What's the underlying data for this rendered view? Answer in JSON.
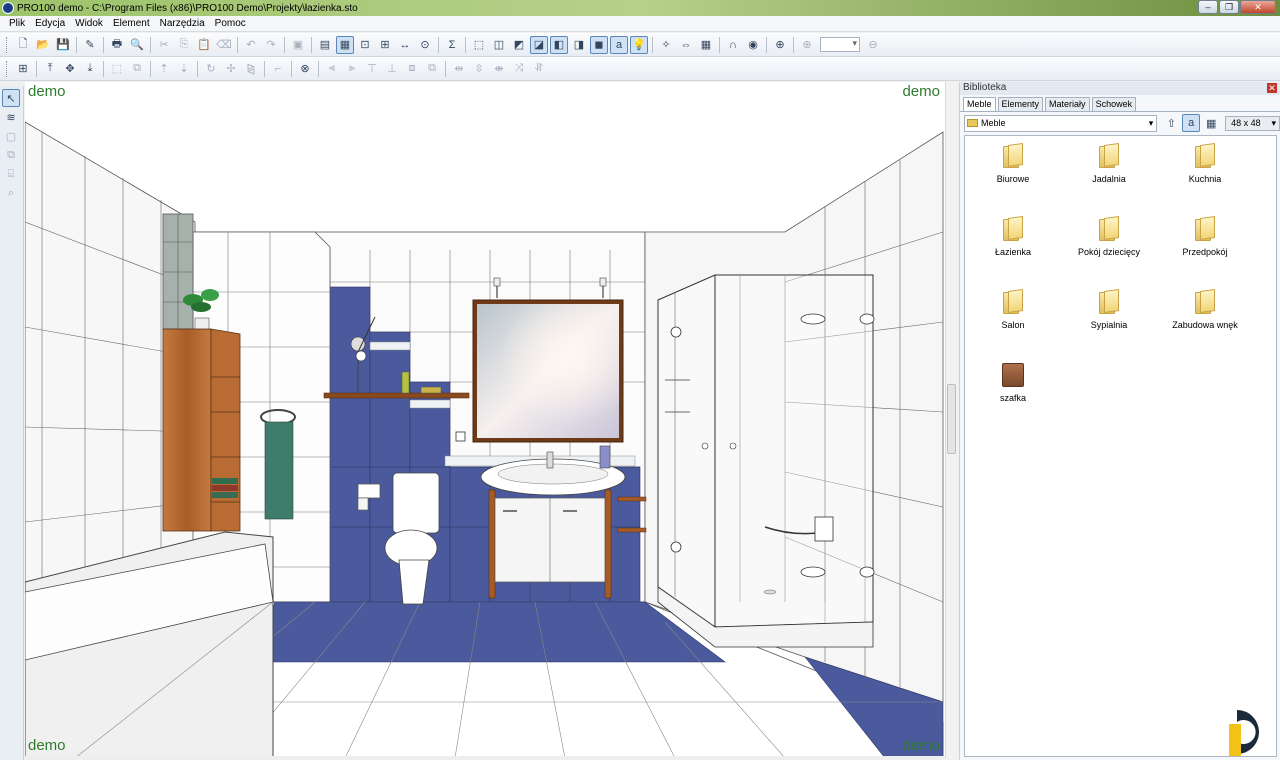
{
  "window": {
    "title": "PRO100 demo - C:\\Program Files (x86)\\PRO100 Demo\\Projekty\\łazienka.sto",
    "buttons": [
      "–",
      "❐",
      "✕"
    ]
  },
  "menubar": {
    "items": [
      "Plik",
      "Edycja",
      "Widok",
      "Element",
      "Narzędzia",
      "Pomoc"
    ]
  },
  "toolbar": {
    "zoom_value": ""
  },
  "viewport": {
    "watermark": "demo"
  },
  "library": {
    "title": "Biblioteka",
    "close_label": "✕",
    "tabs": [
      "Meble",
      "Elementy",
      "Materiały",
      "Schowek"
    ],
    "active_tab": "Meble",
    "path": "Meble",
    "icon_size": "48 x 48",
    "items": [
      {
        "label": "Biurowe",
        "type": "folder"
      },
      {
        "label": "Jadalnia",
        "type": "folder"
      },
      {
        "label": "Kuchnia",
        "type": "folder"
      },
      {
        "label": "Łazienka",
        "type": "folder"
      },
      {
        "label": "Pokój dziecięcy",
        "type": "folder"
      },
      {
        "label": "Przedpokój",
        "type": "folder"
      },
      {
        "label": "Salon",
        "type": "folder"
      },
      {
        "label": "Sypialnia",
        "type": "folder"
      },
      {
        "label": "Zabudowa wnęk",
        "type": "folder"
      },
      {
        "label": "szafka",
        "type": "item"
      }
    ]
  },
  "colors": {
    "accent_blue": "#4a5a9c",
    "wood": "#b5642d",
    "demo_green": "#2e7c2e"
  }
}
